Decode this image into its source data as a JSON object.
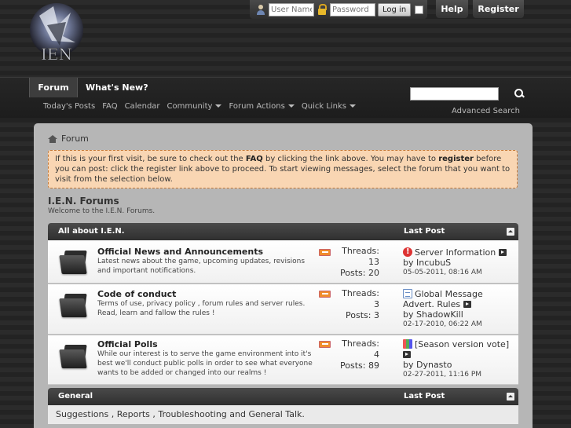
{
  "header": {
    "logo_text": "IEN",
    "login": {
      "username_placeholder": "User Name",
      "password_placeholder": "Password",
      "login_button": "Log in"
    },
    "help_label": "Help",
    "register_label": "Register"
  },
  "navbar": {
    "tabs": [
      {
        "label": "Forum"
      },
      {
        "label": "What's New?"
      }
    ],
    "subnav": [
      {
        "label": "Today's Posts"
      },
      {
        "label": "FAQ"
      },
      {
        "label": "Calendar"
      },
      {
        "label": "Community"
      },
      {
        "label": "Forum Actions"
      },
      {
        "label": "Quick Links"
      }
    ],
    "advanced_search": "Advanced Search"
  },
  "breadcrumb": "Forum",
  "notice": {
    "p1": "If this is your first visit, be sure to check out the ",
    "faq": "FAQ",
    "p2": " by clicking the link above. You may have to ",
    "register": "register",
    "p3": " before you can post: click the register link above to proceed. To start viewing messages, select the forum that you want to visit from the selection below."
  },
  "forum": {
    "title": "I.E.N. Forums",
    "description": "Welcome to the I.E.N. Forums."
  },
  "categories": [
    {
      "name": "All about I.E.N.",
      "last_post_label": "Last Post",
      "forums": [
        {
          "name": "Official News and Announcements",
          "description": "Latest news about the game, upcoming updates, revisions and important notifications.",
          "threads_label": "Threads:",
          "threads": "13",
          "posts_label": "Posts:",
          "posts": "20",
          "last_post_title": "Server Information",
          "last_post_icon": "warning-icon",
          "last_post_by": "by IncubuS",
          "last_post_date": "05-05-2011,",
          "last_post_time": "08:16 AM"
        },
        {
          "name": "Code of conduct",
          "description": "Terms of use, privacy policy , forum rules and server rules. Read, learn and fallow the rules !",
          "threads_label": "Threads:",
          "threads": "3",
          "posts_label": "Posts:",
          "posts": "3",
          "last_post_title": "Global Message Advert. Rules",
          "last_post_icon": "document-icon",
          "last_post_by": "by ShadowKill",
          "last_post_date": "02-17-2010,",
          "last_post_time": "06:22 AM"
        },
        {
          "name": "Official Polls",
          "description": "While our interest is to serve the game environment into it's best we'll conduct public polls in order to see what everyone wants to be added or changed into our realms !",
          "threads_label": "Threads:",
          "threads": "4",
          "posts_label": "Posts:",
          "posts": "89",
          "last_post_title": "[Season version vote]",
          "last_post_icon": "poll-icon",
          "last_post_by": "by Dynasto",
          "last_post_date": "02-27-2011,",
          "last_post_time": "11:16 PM"
        }
      ]
    },
    {
      "name": "General",
      "last_post_label": "Last Post",
      "description": "Suggestions , Reports , Troubleshooting and General Talk."
    }
  ]
}
